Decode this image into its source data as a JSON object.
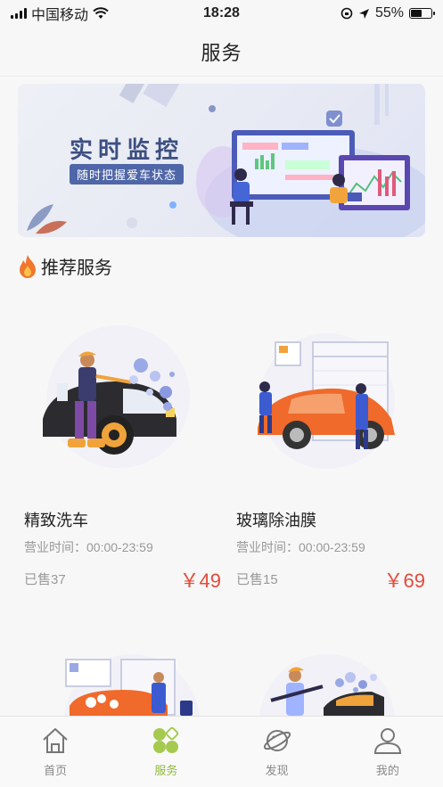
{
  "status_bar": {
    "carrier": "中国移动",
    "time": "18:28",
    "battery": "55%",
    "battery_level": 0.55
  },
  "nav": {
    "title": "服务"
  },
  "banner": {
    "title": "实时监控",
    "subtitle": "随时把握爱车状态"
  },
  "section": {
    "title": "推荐服务",
    "icon": "flame-icon"
  },
  "services": [
    {
      "name": "精致洗车",
      "hours": "营业时间：00:00-23:59",
      "sold": "已售37",
      "price": "￥49"
    },
    {
      "name": "玻璃除油膜",
      "hours": "营业时间：00:00-23:59",
      "sold": "已售15",
      "price": "￥69"
    }
  ],
  "tabs": [
    {
      "label": "首页",
      "icon": "home-icon"
    },
    {
      "label": "服务",
      "icon": "clover-icon",
      "active": true
    },
    {
      "label": "发现",
      "icon": "planet-icon"
    },
    {
      "label": "我的",
      "icon": "user-icon"
    }
  ],
  "colors": {
    "accent": "#8fb83a",
    "price": "#e34b3b",
    "banner_text": "#3d4f82"
  }
}
